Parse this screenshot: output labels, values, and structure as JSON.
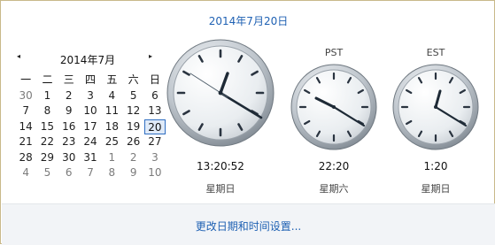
{
  "header": {
    "date_title": "2014年7月20日"
  },
  "calendar": {
    "month_title": "2014年7月",
    "prev_arrow": "◂",
    "next_arrow": "▸",
    "weekdays": [
      "一",
      "二",
      "三",
      "四",
      "五",
      "六",
      "日"
    ],
    "weeks": [
      [
        "30",
        "1",
        "2",
        "3",
        "4",
        "5",
        "6"
      ],
      [
        "7",
        "8",
        "9",
        "10",
        "11",
        "12",
        "13"
      ],
      [
        "14",
        "15",
        "16",
        "17",
        "18",
        "19",
        "20"
      ],
      [
        "21",
        "22",
        "23",
        "24",
        "25",
        "26",
        "27"
      ],
      [
        "28",
        "29",
        "30",
        "31",
        "1",
        "2",
        "3"
      ],
      [
        "4",
        "5",
        "6",
        "7",
        "8",
        "9",
        "10"
      ]
    ],
    "today": "20"
  },
  "clocks": [
    {
      "label": "",
      "time": "13:20:52",
      "day": "星期日"
    },
    {
      "label": "PST",
      "time": "22:20",
      "day": "星期六"
    },
    {
      "label": "EST",
      "time": "1:20",
      "day": "星期日"
    }
  ],
  "footer": {
    "link": "更改日期和时间设置..."
  },
  "colors": {
    "link": "#1f61b3",
    "border": "#c9b98a",
    "today_border": "#2f6ec2"
  }
}
